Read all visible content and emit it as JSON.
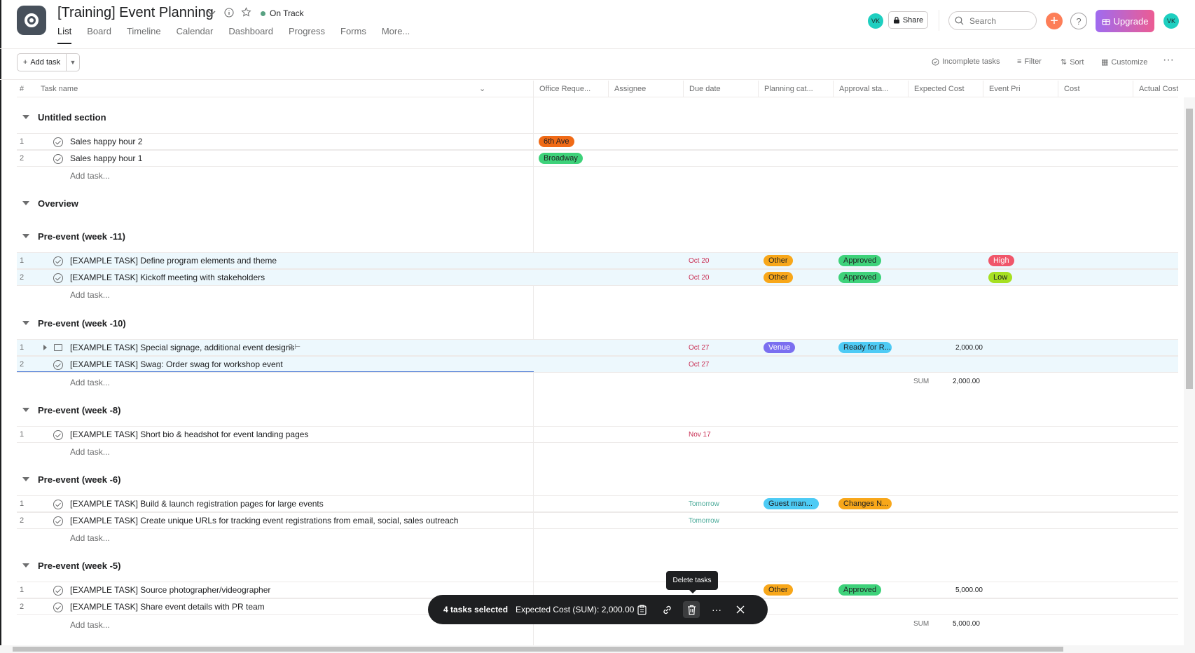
{
  "header": {
    "title": "[Training] Event Planning",
    "status": "On Track",
    "tabs": [
      "List",
      "Board",
      "Timeline",
      "Calendar",
      "Dashboard",
      "Progress",
      "Forms",
      "More..."
    ],
    "avatar_initials": "VK",
    "share_label": "Share",
    "search_placeholder": "Search",
    "upgrade_label": "Upgrade"
  },
  "toolbar": {
    "add_task_label": "Add task",
    "incomplete_label": "Incomplete tasks",
    "filter_label": "Filter",
    "sort_label": "Sort",
    "customize_label": "Customize"
  },
  "columns": [
    "#",
    "Task name",
    "Office Reque...",
    "Assignee",
    "Due date",
    "Planning cat...",
    "Approval sta...",
    "Expected Cost",
    "Event Pri",
    "Cost",
    "Actual Cost"
  ],
  "add_task_row": "Add task...",
  "sections": [
    {
      "title": "Untitled section",
      "tasks": [
        {
          "num": "1",
          "name": "Sales happy hour 2",
          "office": "6th Ave"
        },
        {
          "num": "2",
          "name": "Sales happy hour 1",
          "office": "Broadway"
        }
      ]
    },
    {
      "title": "Overview",
      "tasks": []
    },
    {
      "title": "Pre-event (week -11)",
      "tasks": [
        {
          "num": "1",
          "name": "[EXAMPLE TASK] Define program elements and theme",
          "due": "Oct 20",
          "planning": "Other",
          "approval": "Approved",
          "priority": "High"
        },
        {
          "num": "2",
          "name": "[EXAMPLE TASK] Kickoff meeting with stakeholders",
          "due": "Oct 20",
          "planning": "Other",
          "approval": "Approved",
          "priority": "Low"
        }
      ]
    },
    {
      "title": "Pre-event (week -10)",
      "tasks": [
        {
          "num": "1",
          "name": "[EXAMPLE TASK] Special signage, additional event designs",
          "subtasks": "2",
          "due": "Oct 27",
          "planning": "Venue",
          "approval": "Ready for R...",
          "expected": "2,000.00"
        },
        {
          "num": "2",
          "name": "[EXAMPLE TASK] Swag: Order swag for workshop event",
          "due": "Oct 27"
        }
      ],
      "sum_label": "SUM",
      "sum_value": "2,000.00"
    },
    {
      "title": "Pre-event (week -8)",
      "tasks": [
        {
          "num": "1",
          "name": "[EXAMPLE TASK] Short bio & headshot for event landing pages",
          "due": "Nov 17"
        }
      ]
    },
    {
      "title": "Pre-event (week -6)",
      "tasks": [
        {
          "num": "1",
          "name": "[EXAMPLE TASK] Build & launch registration pages for large events",
          "due": "Tomorrow",
          "planning": "Guest man...",
          "approval": "Changes N..."
        },
        {
          "num": "2",
          "name": "[EXAMPLE TASK] Create unique URLs for tracking event registrations from email, social, sales outreach",
          "due": "Tomorrow"
        }
      ]
    },
    {
      "title": "Pre-event (week -5)",
      "tasks": [
        {
          "num": "1",
          "name": "[EXAMPLE TASK] Source photographer/videographer",
          "planning": "Other",
          "approval": "Approved",
          "expected": "5,000.00"
        },
        {
          "num": "2",
          "name": "[EXAMPLE TASK] Share event details with PR team"
        }
      ],
      "sum_label": "SUM",
      "sum_value": "5,000.00"
    }
  ],
  "selection_bar": {
    "count_label": "4 tasks selected",
    "cost_label": "Expected Cost (SUM): 2,000.00",
    "tooltip": "Delete tasks"
  },
  "colors": {
    "6th Ave": "#f06a16",
    "Broadway": "#3ed27a",
    "Other": "#f8a71a",
    "Approved": "#3ed27a",
    "High": "#f0566a",
    "Low": "#a6e022",
    "Venue": "#7a6ff0",
    "Ready for R...": "#4ecbf5",
    "Guest man...": "#4ecbf5",
    "Changes N...": "#f8a71a"
  }
}
